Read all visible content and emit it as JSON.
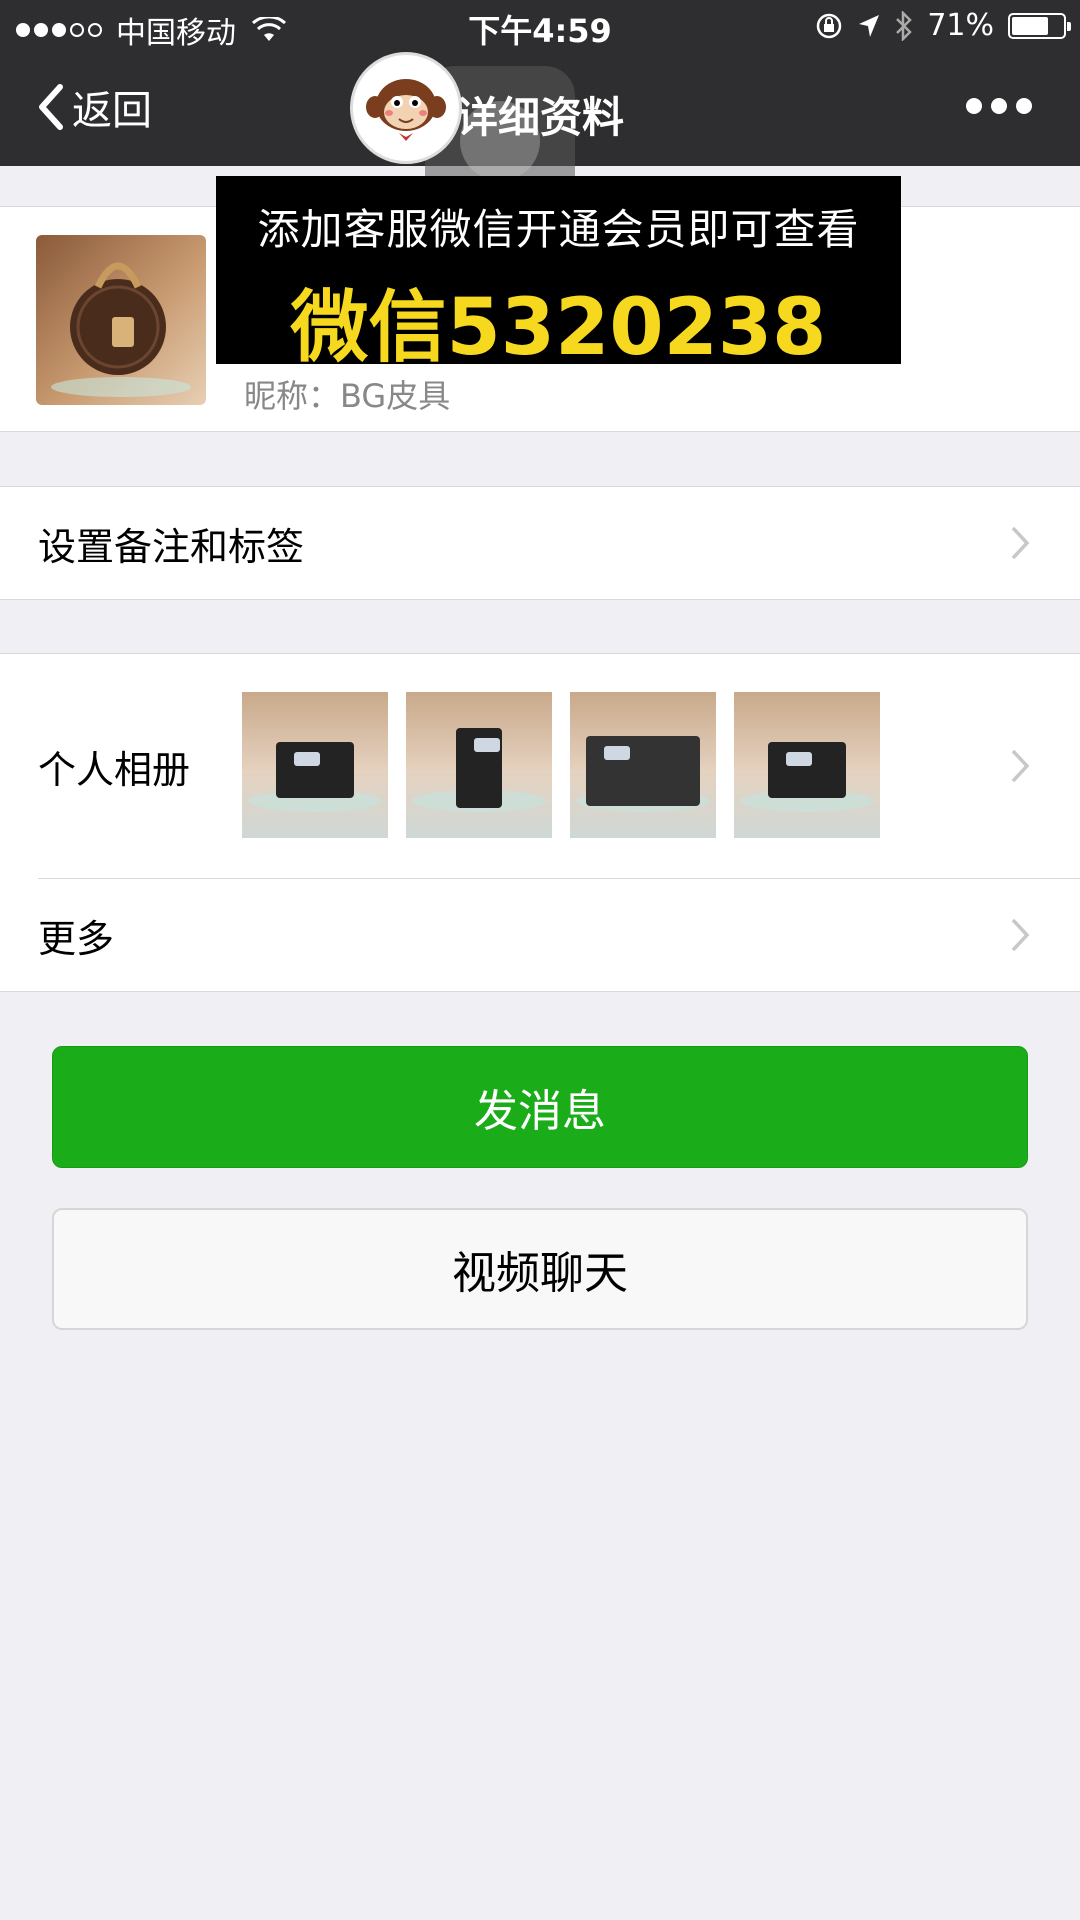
{
  "status_bar": {
    "carrier": "中国移动",
    "time": "下午4:59",
    "battery_percent": "71%",
    "battery_level": 0.71,
    "signal_icon": "signal-dots-icon",
    "wifi_icon": "wifi-icon",
    "lock_icon": "rotation-lock-icon",
    "location_icon": "location-arrow-icon",
    "bluetooth_icon": "bluetooth-icon"
  },
  "navbar": {
    "back_label": "返回",
    "title": "详细资料",
    "more_icon": "more-dots-icon"
  },
  "banner": {
    "line1": "添加客服微信开通会员即可查看",
    "line2": "微信5320238"
  },
  "profile": {
    "nickname": "昵称：BG皮具"
  },
  "cells": {
    "remark": "设置备注和标签",
    "album": "个人相册",
    "more": "更多"
  },
  "buttons": {
    "send_message": "发消息",
    "video_chat": "视频聊天"
  },
  "colors": {
    "navbar_bg": "#2e2e30",
    "primary_green": "#1aad19",
    "banner_text_yellow": "#f6d91e",
    "page_bg": "#efeff4"
  }
}
